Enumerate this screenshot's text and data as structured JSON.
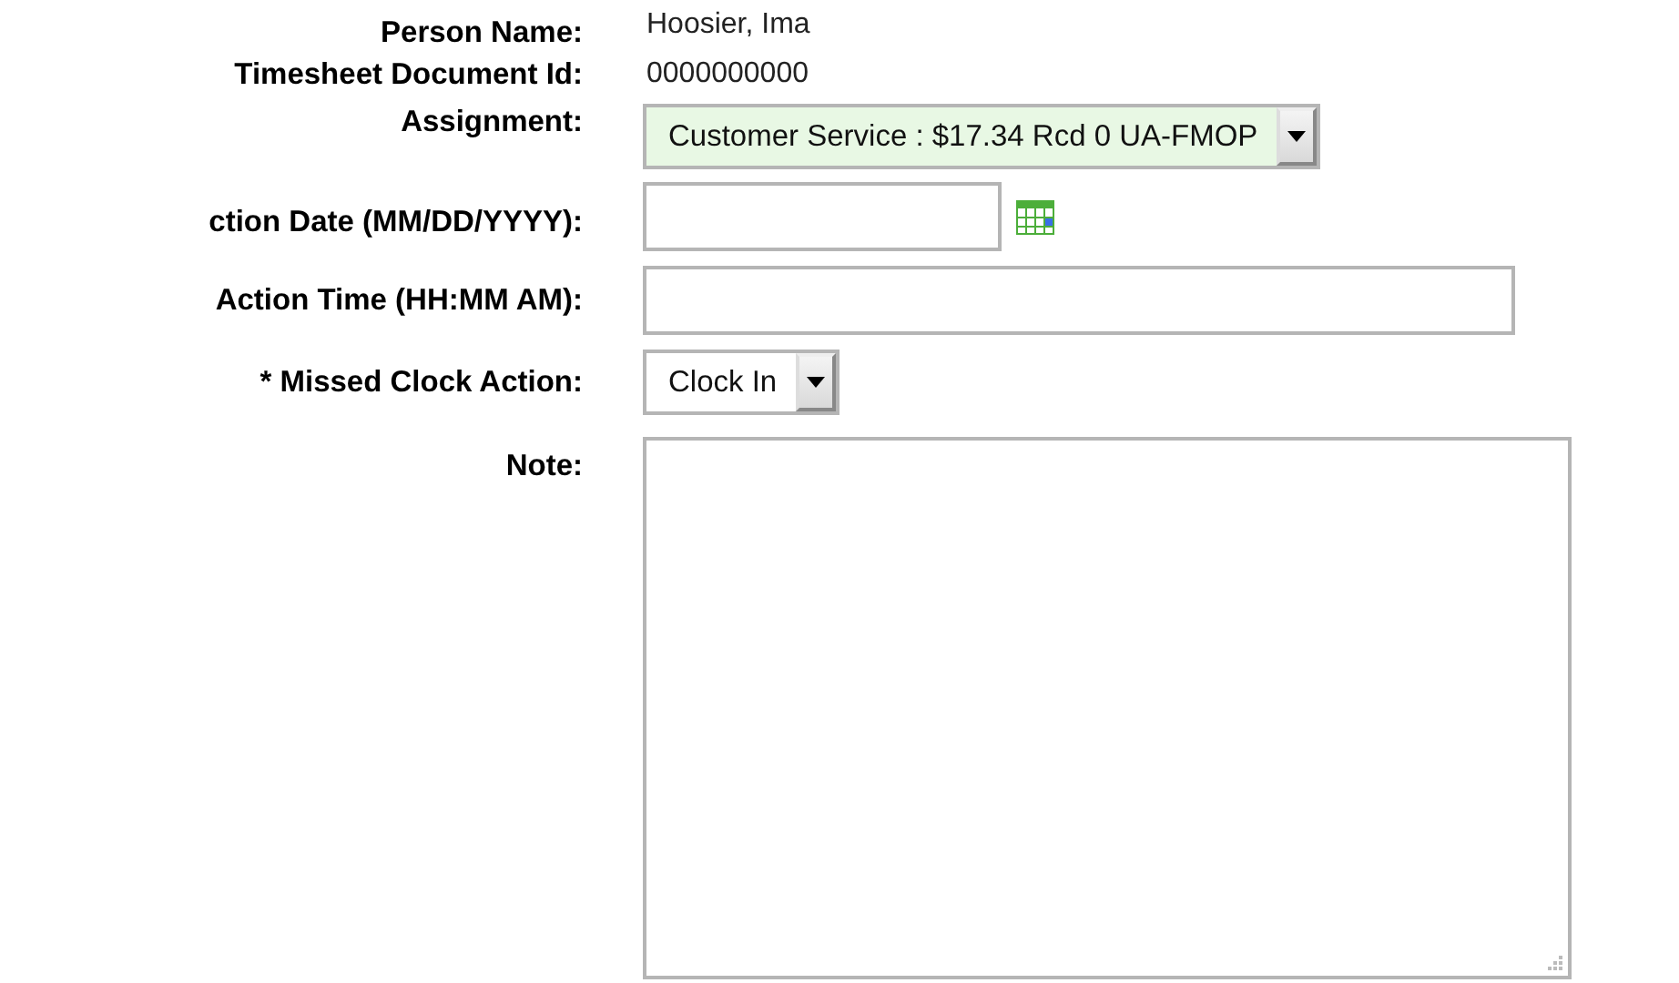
{
  "form": {
    "rows": [
      {
        "kind": "text",
        "label": "Person Name:",
        "value": "Hoosier, Ima"
      },
      {
        "kind": "text",
        "label": "Timesheet Document Id:",
        "value": "0000000000"
      },
      {
        "kind": "select",
        "label": "Assignment:",
        "value": "Customer Service : $17.34 Rcd 0 UA-FMOP",
        "highlighted": true
      },
      {
        "kind": "date",
        "label": "ction Date (MM/DD/YYYY):"
      },
      {
        "kind": "input",
        "label": "Action Time (HH:MM AM):"
      },
      {
        "kind": "select",
        "label": "* Missed Clock Action:",
        "value": "Clock In",
        "highlighted": false
      },
      {
        "kind": "textarea",
        "label": "Note:"
      }
    ]
  }
}
